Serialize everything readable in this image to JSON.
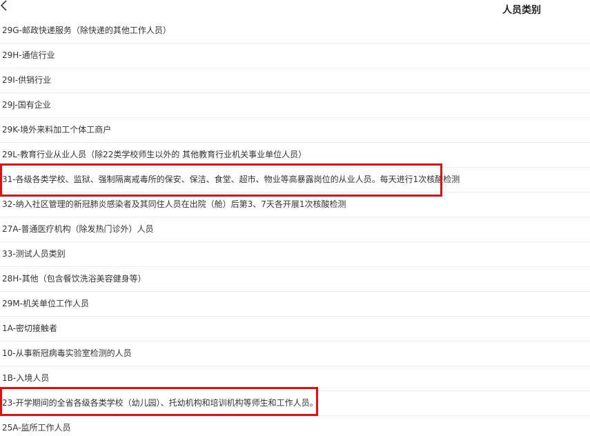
{
  "header": {
    "back_icon": "chevron-left-icon",
    "title": "人员类别"
  },
  "list": {
    "items": [
      {
        "label": "29G-邮政快递服务（除快递的其他工作人员）"
      },
      {
        "label": "29H-通信行业"
      },
      {
        "label": "29I-供销行业"
      },
      {
        "label": "29J-国有企业"
      },
      {
        "label": "29K-境外来料加工个体工商户"
      },
      {
        "label": "29L-教育行业从业人员（除22类学校师生以外的 其他教育行业机关事业单位人员）"
      },
      {
        "label": "31-各级各类学校、监狱、强制隔离戒毒所的保安、保洁、食堂、超市、物业等高暴露岗位的从业人员。每天进行1次核酸检测"
      },
      {
        "label": "32-纳入社区管理的新冠肺炎感染者及其同住人员在出院（舱）后第3、7天各开展1次核酸检测"
      },
      {
        "label": "27A-普通医疗机构（除发热门诊外）人员"
      },
      {
        "label": "33-测试人员类别"
      },
      {
        "label": "28H-其他（包含餐饮洗浴美容健身等）"
      },
      {
        "label": "29M-机关单位工作人员"
      },
      {
        "label": "1A-密切接触者"
      },
      {
        "label": "10-从事新冠病毒实验室检测的人员"
      },
      {
        "label": "1B-入境人员"
      },
      {
        "label": "23-开学期间的全省各级各类学校（幼儿园）、托幼机构和培训机构等师生和工作人员。"
      },
      {
        "label": "25A-监所工作人员"
      }
    ]
  },
  "annotations": {
    "highlight_color": "#e01010"
  }
}
